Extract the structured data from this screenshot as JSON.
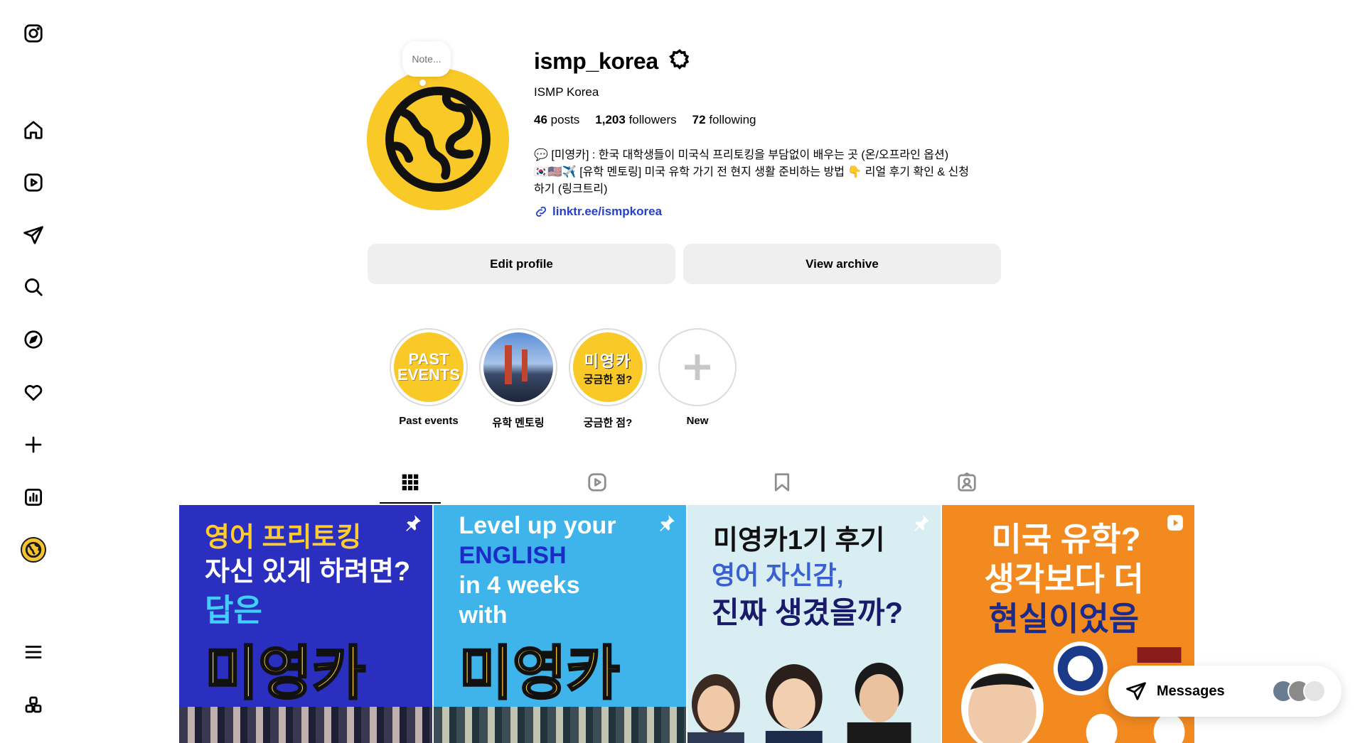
{
  "profile": {
    "username": "ismp_korea",
    "full_name": "ISMP Korea",
    "note_placeholder": "Note...",
    "stats": {
      "posts_count": "46",
      "posts_label": "posts",
      "followers_count": "1,203",
      "followers_label": "followers",
      "following_count": "72",
      "following_label": "following"
    },
    "bio_lines": [
      "💬 [미영카] : 한국 대학생들이 미국식 프리토킹을 부담없이 배우는 곳 (온/오프라인 옵션)",
      "🇰🇷🇺🇸✈️ [유학 멘토링] 미국 유학 가기 전 현지 생활 준비하는 방법 👇 리얼 후기 확인 & 신청",
      "하기 (링크트리)"
    ],
    "link": "linktr.ee/ismpkorea",
    "accent_color": "#f9c928",
    "link_color": "#2840c8"
  },
  "actions": {
    "edit_profile": "Edit profile",
    "view_archive": "View archive"
  },
  "highlights": [
    {
      "label": "Past events",
      "cover_line1": "PAST",
      "cover_line2": "EVENTS"
    },
    {
      "label": "유학 멘토링"
    },
    {
      "label": "궁금한 점?",
      "cover_line1": "미영카",
      "cover_line2": "궁금한 점?"
    },
    {
      "label": "New",
      "icon": "plus-icon"
    }
  ],
  "tabs": [
    {
      "name": "posts",
      "icon": "grid-icon",
      "active": true
    },
    {
      "name": "reels",
      "icon": "reels-icon",
      "active": false
    },
    {
      "name": "saved",
      "icon": "bookmark-icon",
      "active": false
    },
    {
      "name": "tagged",
      "icon": "tagged-icon",
      "active": false
    }
  ],
  "posts": [
    {
      "lines": [
        "영어 프리토킹",
        "자신 있게 하려면?",
        "답은",
        "미영카"
      ],
      "pinned": true
    },
    {
      "lines": [
        "Level up your",
        "ENGLISH",
        "in 4 weeks",
        "with",
        "미영카"
      ],
      "pinned": true
    },
    {
      "lines": [
        "미영카1기 후기",
        "영어 자신감,",
        "진짜 생겼을까?"
      ],
      "pinned": true
    },
    {
      "lines": [
        "미국 유학?",
        "생각보다 더",
        "현실이었음"
      ],
      "reel": true
    }
  ],
  "messages": {
    "label": "Messages"
  },
  "sidebar": {
    "items": [
      "instagram-logo-icon",
      "home-icon",
      "reels-icon",
      "messages-icon",
      "search-icon",
      "explore-icon",
      "notifications-icon",
      "create-icon",
      "dashboard-icon",
      "profile-avatar",
      "more-icon",
      "also-from-meta-icon"
    ]
  }
}
